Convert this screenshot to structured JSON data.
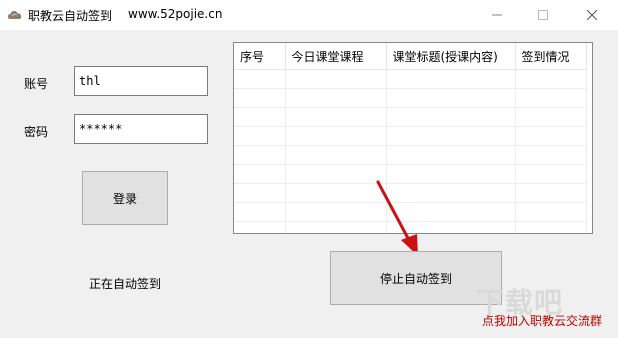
{
  "window": {
    "title": "职教云自动签到",
    "url_text": "www.52pojie.cn"
  },
  "login": {
    "account_label": "账号",
    "account_value": "thl",
    "password_label": "密码",
    "password_value": "******",
    "login_button": "登录"
  },
  "status": {
    "text": "正在自动签到"
  },
  "table": {
    "columns": [
      "序号",
      "今日课堂课程",
      "课堂标题(授课内容)",
      "签到情况"
    ],
    "rows": []
  },
  "actions": {
    "stop_button": "停止自动签到",
    "join_link": "点我加入职教云交流群"
  },
  "watermark": "下载吧",
  "colors": {
    "link": "#c00000",
    "arrow": "#cc1111",
    "window_bg": "#f0f0f0"
  }
}
